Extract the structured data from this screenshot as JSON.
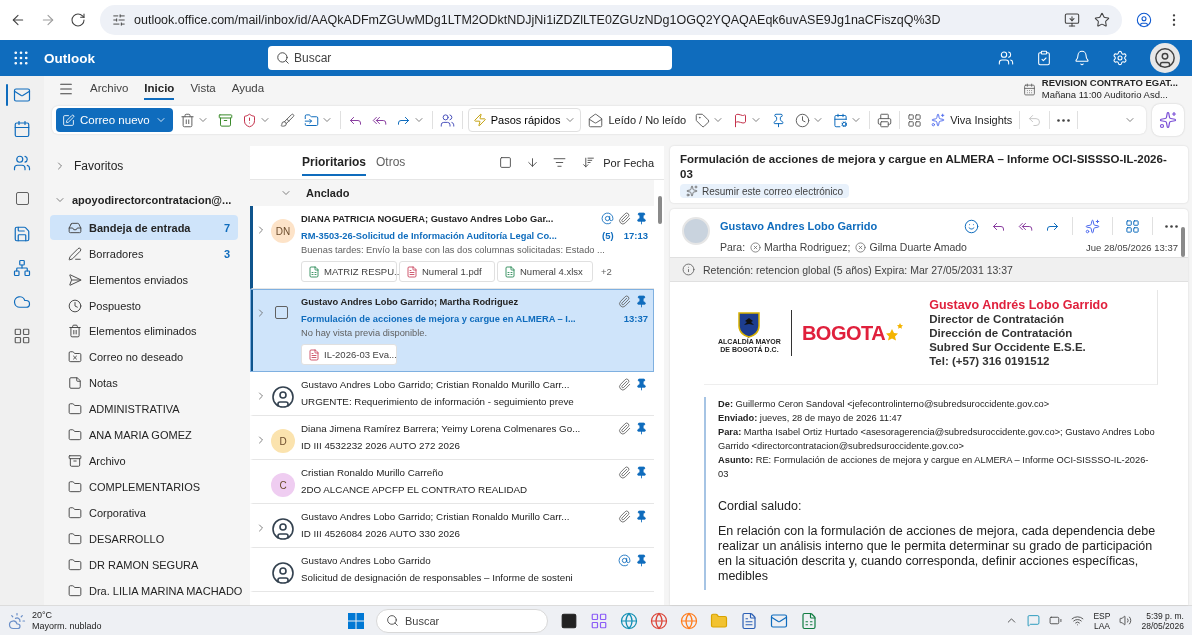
{
  "browser": {
    "url": "outlook.office.com/mail/inbox/id/AAQkADFmZGUwMDg1LTM2ODktNDJjNi1iZDZlLTE0ZGUzNDg1OGQ2YQAQAEqk6uvASE9Jg1naCFiszqQ%3D"
  },
  "header": {
    "app_name": "Outlook",
    "search_placeholder": "Buscar"
  },
  "ribbon": {
    "tabs": [
      {
        "label": "Archivo",
        "selected": false
      },
      {
        "label": "Inicio",
        "selected": true
      },
      {
        "label": "Vista",
        "selected": false
      },
      {
        "label": "Ayuda",
        "selected": false
      }
    ],
    "reminder": {
      "title": "REVISION CONTRATO EGAT...",
      "detail": "Mañana 11:00 Auditorio Asd..."
    },
    "new_mail": "Correo nuevo",
    "quick_steps": "Pasos rápidos",
    "read_unread": "Leído / No leído",
    "viva": "Viva Insights",
    "undo_disabled": true
  },
  "folders": {
    "favorites": {
      "label": "Favoritos",
      "expanded": false
    },
    "account": {
      "label": "apoyodirectorcontratacion@...",
      "expanded": true
    },
    "items": [
      {
        "kind": "inbox",
        "label": "Bandeja de entrada",
        "count": "7",
        "selected": true
      },
      {
        "kind": "drafts",
        "label": "Borradores",
        "count": "3",
        "selected": false
      },
      {
        "kind": "sent",
        "label": "Elementos enviados",
        "selected": false
      },
      {
        "kind": "snoozed",
        "label": "Pospuesto",
        "selected": false
      },
      {
        "kind": "deleted",
        "label": "Elementos eliminados",
        "selected": false
      },
      {
        "kind": "junk",
        "label": "Correo no deseado",
        "selected": false
      },
      {
        "kind": "notes",
        "label": "Notas",
        "selected": false
      },
      {
        "kind": "folder",
        "label": "ADMINISTRATIVA",
        "selected": false
      },
      {
        "kind": "folder",
        "label": "ANA MARIA GOMEZ",
        "selected": false
      },
      {
        "kind": "archive",
        "label": "Archivo",
        "selected": false
      },
      {
        "kind": "folder",
        "label": "COMPLEMENTARIOS",
        "selected": false
      },
      {
        "kind": "folder",
        "label": "Corporativa",
        "selected": false
      },
      {
        "kind": "folder",
        "label": "DESARROLLO",
        "selected": false
      },
      {
        "kind": "folder",
        "label": "DR RAMON SEGURA",
        "selected": false
      },
      {
        "kind": "folder",
        "label": "Dra. LILIA MARINA MACHADO",
        "selected": false
      }
    ]
  },
  "message_list": {
    "tabs": [
      {
        "label": "Prioritarios",
        "selected": true
      },
      {
        "label": "Otros",
        "selected": false
      }
    ],
    "sort": "Por Fecha",
    "group": {
      "label": "Anclado",
      "expanded": true
    },
    "messages": [
      {
        "avatar": {
          "kind": "initials",
          "text": "DN",
          "color": "#fde3c8"
        },
        "expandable": true,
        "unread": true,
        "selected": false,
        "sender": "DIANA PATRICIA NOGUERA; Gustavo Andres Lobo Gar...",
        "subject": "RM-3503-26-Solicitud de Información Auditoría Legal Co...",
        "count": "(5)",
        "time": "17:13",
        "preview": "Buenas tardes: Envío la base con las dos columnas solicitadas: Estado ...",
        "attachments": [
          {
            "kind": "excel",
            "name": "MATRIZ RESPU..."
          },
          {
            "kind": "pdf",
            "name": "Numeral 1.pdf"
          },
          {
            "kind": "excel",
            "name": "Numeral 4.xlsx"
          }
        ],
        "more_attachments": "+2",
        "mention": true,
        "has_attachment": true,
        "pinned": true
      },
      {
        "avatar": {
          "kind": "checkbox",
          "checked": false
        },
        "expandable": true,
        "unread": true,
        "selected": true,
        "sender": "Gustavo Andres Lobo Garrido; Martha Rodriguez",
        "subject": "Formulación de acciones de mejora y cargue en ALMERA – I...",
        "time": "13:37",
        "preview": "No hay vista previa disponible.",
        "attachments": [
          {
            "kind": "pdf",
            "name": "IL-2026-03 Eva..."
          }
        ],
        "mention": false,
        "has_attachment": true,
        "pinned": true
      },
      {
        "avatar": {
          "kind": "photo"
        },
        "expandable": true,
        "unread": false,
        "selected": false,
        "sender": "Gustavo Andres Lobo Garrido; Cristian Ronaldo Murillo Carr...",
        "subject": "URGENTE: Requerimiento de información - seguimiento preve",
        "mention": false,
        "has_attachment": true,
        "pinned": true
      },
      {
        "avatar": {
          "kind": "initials",
          "text": "D",
          "color": "#fbe3ae"
        },
        "expandable": true,
        "unread": false,
        "selected": false,
        "sender": "Diana Jimena Ramírez Barrera; Yeimy Lorena Colmenares Go...",
        "subject": "ID III 4532232 2026 AUTO 272 2026",
        "mention": false,
        "has_attachment": true,
        "pinned": true
      },
      {
        "avatar": {
          "kind": "initials",
          "text": "C",
          "color": "#efcdf1"
        },
        "expandable": false,
        "unread": false,
        "selected": false,
        "sender": "Cristian Ronaldo Murillo Carreño",
        "subject": "2DO ALCANCE APCFP EL CONTRATO REALIDAD",
        "mention": false,
        "has_attachment": true,
        "pinned": true
      },
      {
        "avatar": {
          "kind": "photo"
        },
        "expandable": true,
        "unread": false,
        "selected": false,
        "sender": "Gustavo Andres Lobo Garrido; Cristian Ronaldo Murillo Carr...",
        "subject": "ID III 4526084 2026 AUTO 330 2026",
        "mention": false,
        "has_attachment": true,
        "pinned": true
      },
      {
        "avatar": {
          "kind": "photo"
        },
        "expandable": false,
        "unread": false,
        "selected": false,
        "sender": "Gustavo Andres Lobo Garrido",
        "subject": "Solicitud de designación de responsables – Informe de sosteni",
        "mention": true,
        "has_attachment": false,
        "pinned": true
      }
    ]
  },
  "reading": {
    "subject": "Formulación de acciones de mejora y cargue en ALMERA – Informe OCI-SISSSO-IL-2026-03",
    "summarize": "Resumir este correo electrónico",
    "sender": "Gustavo Andres Lobo Garrido",
    "to_label": "Para:",
    "recipients": [
      "Martha Rodriguez;",
      "Gilma Duarte Amado"
    ],
    "date": "Jue 28/05/2026 13:37",
    "retention": "Retención: retencion global (5 años) Expira: Mar 27/05/2031 13:37",
    "signature": {
      "crest_caption": [
        "ALCALDÍA MAYOR",
        "DE BOGOTÁ D.C."
      ],
      "wordmark": "BOGOTA",
      "name": "Gustavo Andrés Lobo Garrido",
      "lines": [
        "Director de Contratación",
        "Dirección de Contratación",
        "Subred Sur Occidente E.S.E.",
        "Tel: (+57) 316 0191512"
      ]
    },
    "quoted": [
      "**De:** Guillermo Ceron Sandoval <jefecontrolinterno@subredsuroccidente.gov.co>",
      "**Enviado:** jueves, 28 de mayo de 2026 11:47",
      "**Para:** Martha Isabel Ortiz Hurtado <asesoragerencia@subredsuroccidente.gov.co>; Gustavo Andres Lobo Garrido <directorcontratacion@subredsuroccidente.gov.co>",
      "**Asunto:** RE: Formulación de acciones de mejora y cargue en ALMERA – Informe OCI-SISSSO-IL-2026-03"
    ],
    "body": [
      "Cordial saludo:",
      "En relación con la formulación de acciones de mejora, cada dependencia debe realizar un análisis interno que le permita determinar su grado de participación en la situación descrita y, cuando corresponda, definir acciones específicas, medibles"
    ]
  },
  "taskbar": {
    "temperature": "20°C",
    "condition": "Mayorm. nublado",
    "search_placeholder": "Buscar",
    "language": [
      "ESP",
      "LAA"
    ],
    "time": "5:39 p. m.",
    "date": "28/05/2026"
  }
}
